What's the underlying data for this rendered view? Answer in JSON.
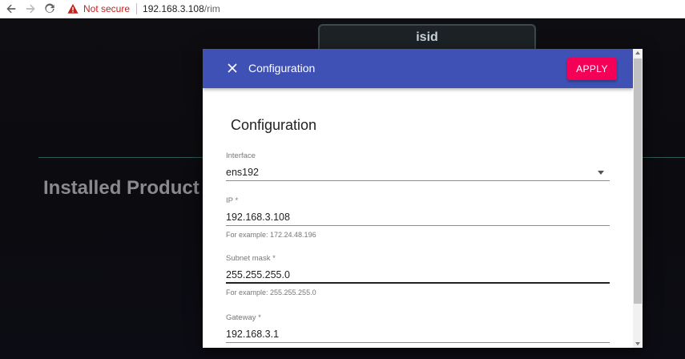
{
  "browser": {
    "security_label": "Not secure",
    "url_host": "192.168.3.108",
    "url_path": "/rim"
  },
  "background": {
    "tab_label": "isid",
    "section_title": "Installed Product"
  },
  "dialog": {
    "title": "Configuration",
    "apply_label": "APPLY",
    "form_heading": "Configuration",
    "header_color": "#3f51b5",
    "apply_color": "#f50057",
    "fields": {
      "interface": {
        "label": "Interface",
        "value": "ens192"
      },
      "ip": {
        "label": "IP *",
        "value": "192.168.3.108",
        "help": "For example: 172.24.48.196"
      },
      "subnet": {
        "label": "Subnet mask *",
        "value": "255.255.255.0",
        "help": "For example: 255.255.255.0"
      },
      "gateway": {
        "label": "Gateway *",
        "value": "192.168.3.1"
      }
    }
  },
  "icons": [
    "back-arrow-icon",
    "forward-arrow-icon",
    "reload-icon",
    "warning-icon",
    "close-icon",
    "chevron-down-icon"
  ]
}
